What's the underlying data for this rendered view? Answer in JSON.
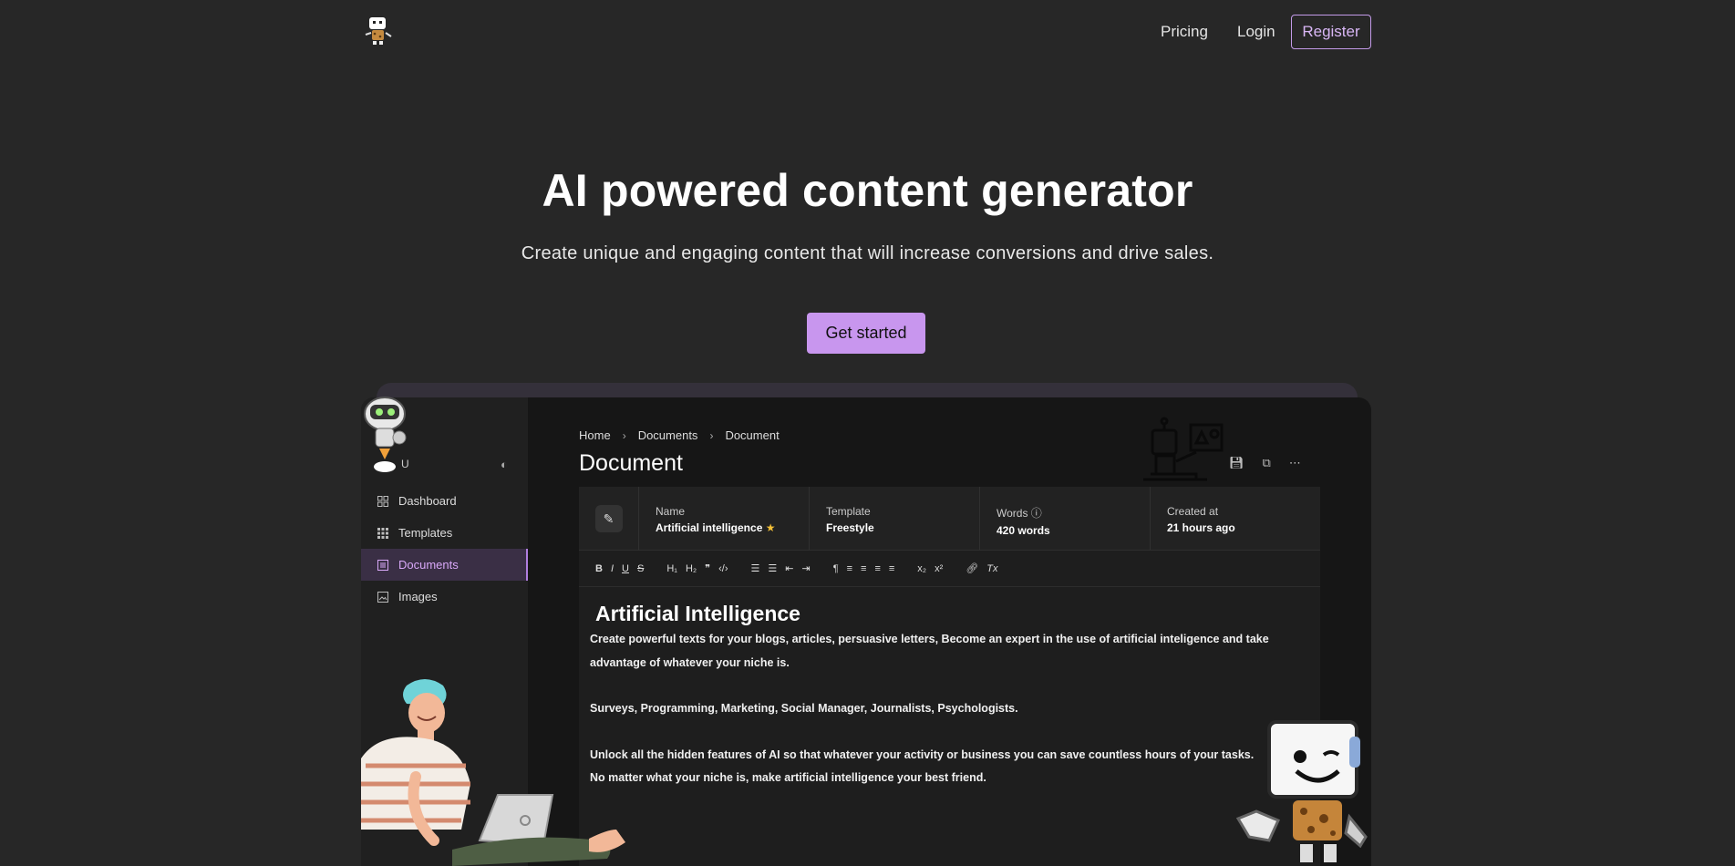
{
  "nav": {
    "pricing": "Pricing",
    "login": "Login",
    "register": "Register"
  },
  "hero": {
    "title": "AI powered content generator",
    "subtitle": "Create unique and engaging content that will increase conversions and drive sales.",
    "cta": "Get started"
  },
  "app": {
    "user_initial": "U",
    "sidebar": {
      "items": [
        {
          "label": "Dashboard",
          "icon": "grid-icon"
        },
        {
          "label": "Templates",
          "icon": "dots-grid-icon"
        },
        {
          "label": "Documents",
          "icon": "document-icon",
          "active": true
        },
        {
          "label": "Images",
          "icon": "image-icon"
        }
      ]
    },
    "breadcrumb": [
      "Home",
      "Documents",
      "Document"
    ],
    "page_title": "Document",
    "meta": {
      "name_label": "Name",
      "name_value": "Artificial intelligence",
      "template_label": "Template",
      "template_value": "Freestyle",
      "words_label": "Words",
      "words_value": "420 words",
      "created_label": "Created at",
      "created_value": "21 hours ago"
    },
    "editor": {
      "heading": "Artificial Intelligence",
      "p1": "Create powerful texts for your blogs, articles, persuasive letters, Become an expert in the use of artificial inteligence and take advantage of whatever your niche is.",
      "p2": "Surveys, Programming, Marketing, Social Manager, Journalists, Psychologists.",
      "p3": "Unlock all the hidden features of AI so that whatever your activity or business you can save countless hours of your tasks.",
      "p4": "No matter what your niche is, make artificial intelligence your best friend."
    }
  },
  "colors": {
    "background": "#272727",
    "accent": "#c896ee",
    "star": "#f3c037"
  }
}
